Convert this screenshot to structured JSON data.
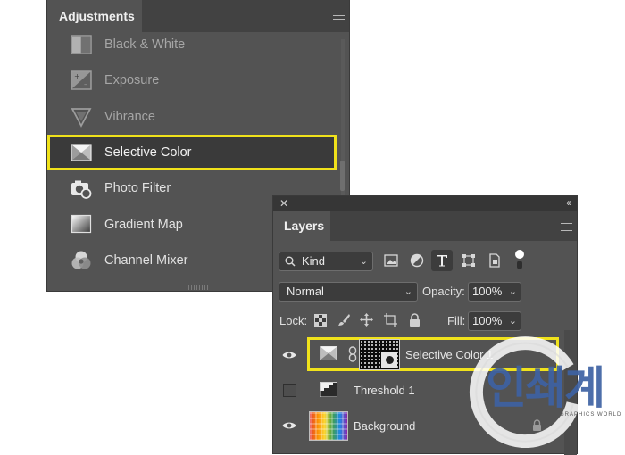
{
  "adjustments": {
    "title": "Adjustments",
    "items": [
      {
        "label": "Black & White",
        "icon": "black-white-icon",
        "state": "dim"
      },
      {
        "label": "Exposure",
        "icon": "exposure-icon",
        "state": "dim"
      },
      {
        "label": "Vibrance",
        "icon": "vibrance-icon",
        "state": "dim"
      },
      {
        "label": "Selective Color",
        "icon": "selective-color-icon",
        "state": "selected"
      },
      {
        "label": "Photo Filter",
        "icon": "photo-filter-icon",
        "state": "normal"
      },
      {
        "label": "Gradient Map",
        "icon": "gradient-map-icon",
        "state": "normal"
      },
      {
        "label": "Channel Mixer",
        "icon": "channel-mixer-icon",
        "state": "normal"
      }
    ]
  },
  "layers": {
    "close_glyph": "✕",
    "collapse_glyph": "‹‹",
    "title": "Layers",
    "filter_kind": "Kind",
    "blend_mode": "Normal",
    "opacity_label": "Opacity:",
    "opacity_value": "100%",
    "lock_label": "Lock:",
    "fill_label": "Fill:",
    "fill_value": "100%",
    "rows": [
      {
        "name": "Selective Color 1",
        "visible": true,
        "highlighted": true
      },
      {
        "name": "Threshold 1",
        "visible": false,
        "highlighted": false
      },
      {
        "name": "Background",
        "visible": true,
        "highlighted": false
      }
    ]
  },
  "colors": {
    "highlight": "#f0e21b",
    "panel_bg": "#535353",
    "selected_bg": "#3a3a3a",
    "watermark_blue": "#3e62a3"
  },
  "watermark": {
    "text": "인쇄계",
    "subtext": "GRAPHICS WORLD"
  }
}
